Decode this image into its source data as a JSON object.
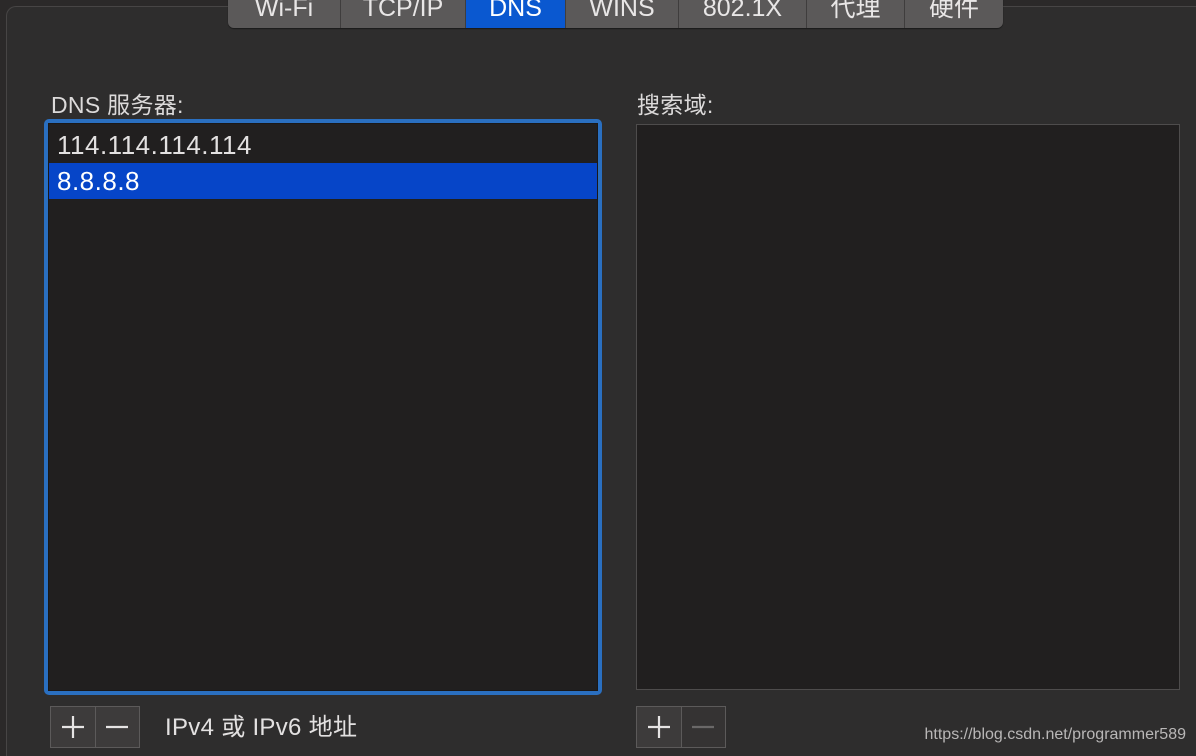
{
  "tabs": [
    {
      "label": "Wi-Fi",
      "selected": false
    },
    {
      "label": "TCP/IP",
      "selected": false
    },
    {
      "label": "DNS",
      "selected": true
    },
    {
      "label": "WINS",
      "selected": false
    },
    {
      "label": "802.1X",
      "selected": false
    },
    {
      "label": "代理",
      "selected": false
    },
    {
      "label": "硬件",
      "selected": false
    }
  ],
  "dns": {
    "label": "DNS 服务器:",
    "servers": [
      {
        "address": "114.114.114.114",
        "selected": false
      },
      {
        "address": "8.8.8.8",
        "selected": true
      }
    ],
    "hint": "IPv4 或 IPv6 地址",
    "add_icon": "plus-icon",
    "remove_icon": "minus-icon"
  },
  "search_domains": {
    "label": "搜索域:",
    "items": [],
    "add_icon": "plus-icon",
    "remove_icon": "minus-icon",
    "remove_enabled": false
  },
  "watermark": "https://blog.csdn.net/programmer589",
  "colors": {
    "accent": "#0a58d0",
    "selection": "#0645c8",
    "focus_ring": "#2a6fc0"
  }
}
